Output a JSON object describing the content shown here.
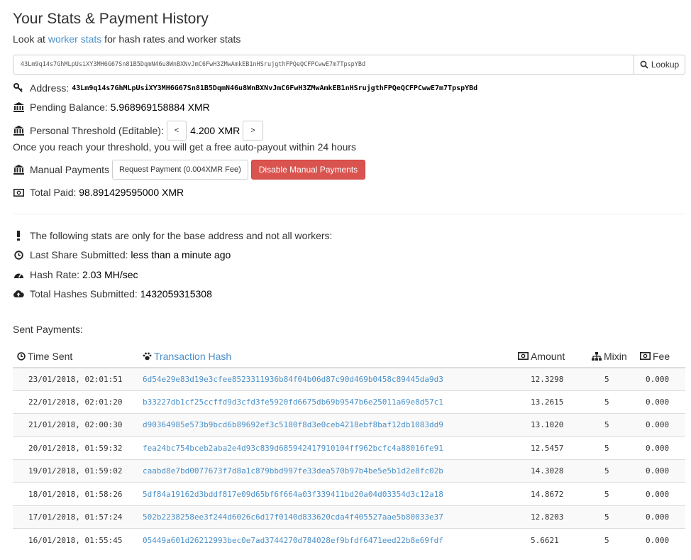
{
  "page": {
    "title": "Your Stats & Payment History",
    "subtitle_prefix": "Look at ",
    "subtitle_link": "worker stats",
    "subtitle_suffix": " for hash rates and worker stats"
  },
  "lookup": {
    "value": "43Lm9q14s7GhMLpUsiXY3MH6G67Sn81B5DqmN46u8WnBXNvJmC6FwH3ZMwAmkEB1nHSrujgthFPQeQCFPCwwE7m7TpspYBd",
    "button_label": "Lookup",
    "button_icon": "search-icon"
  },
  "stats": {
    "address_label": "Address:",
    "address_value": "43Lm9q14s7GhMLpUsiXY3MH6G67Sn81B5DqmN46u8WnBXNvJmC6FwH3ZMwAmkEB1nHSrujgthFPQeQCFPCwwE7m7TpspYBd",
    "pending_label": "Pending Balance:",
    "pending_value": "5.968969158884 XMR",
    "threshold_label": "Personal Threshold (Editable):",
    "threshold_dec": "<",
    "threshold_value": "4.200 XMR",
    "threshold_inc": ">",
    "threshold_note": "Once you reach your threshold, you will get a free auto-payout within 24 hours",
    "manual_label": "Manual Payments",
    "request_button": "Request Payment (0.004XMR Fee)",
    "disable_button": "Disable Manual Payments",
    "total_paid_label": "Total Paid:",
    "total_paid_value": "98.891429595000 XMR"
  },
  "base_stats": {
    "notice": "The following stats are only for the base address and not all workers:",
    "last_share_label": "Last Share Submitted:",
    "last_share_value": "less than a minute ago",
    "hash_rate_label": "Hash Rate:",
    "hash_rate_value": "2.03 MH/sec",
    "total_hashes_label": "Total Hashes Submitted:",
    "total_hashes_value": "1432059315308"
  },
  "payments": {
    "section_label": "Sent Payments:",
    "headers": {
      "time": "Time Sent",
      "hash": "Transaction Hash",
      "amount": "Amount",
      "mixin": "Mixin",
      "fee": "Fee"
    },
    "rows": [
      {
        "time": "23/01/2018, 02:01:51",
        "hash": "6d54e29e83d19e3cfee8523311936b84f04b06d87c90d469b0458c89445da9d3",
        "amount": "12.3298",
        "mixin": "5",
        "fee": "0.000"
      },
      {
        "time": "22/01/2018, 02:01:20",
        "hash": "b33227db1cf25ccffd9d3cfd3fe5920fd6675db69b9547b6e25011a69e8d57c1",
        "amount": "13.2615",
        "mixin": "5",
        "fee": "0.000"
      },
      {
        "time": "21/01/2018, 02:00:30",
        "hash": "d90364985e573b9bcd6b89692ef3c5180f8d3e0ceb4218ebf8baf12db1083dd9",
        "amount": "13.1020",
        "mixin": "5",
        "fee": "0.000"
      },
      {
        "time": "20/01/2018, 01:59:32",
        "hash": "fea24bc754bceb2aba2e4d93c839d685942417910104ff962bcfc4a88016fe91",
        "amount": "12.5457",
        "mixin": "5",
        "fee": "0.000"
      },
      {
        "time": "19/01/2018, 01:59:02",
        "hash": "caabd8e7bd0077673f7d8a1c879bbd997fe33dea570b97b4be5e5b1d2e8fc02b",
        "amount": "14.3028",
        "mixin": "5",
        "fee": "0.000"
      },
      {
        "time": "18/01/2018, 01:58:26",
        "hash": "5df84a19162d3bddf817e09d65bf6f664a03f339411bd20a04d03354d3c12a18",
        "amount": "14.8672",
        "mixin": "5",
        "fee": "0.000"
      },
      {
        "time": "17/01/2018, 01:57:24",
        "hash": "502b2238258ee3f244d6026c6d17f0140d833620cda4f405527aae5b80033e37",
        "amount": "12.8203",
        "mixin": "5",
        "fee": "0.000"
      },
      {
        "time": "16/01/2018, 01:55:45",
        "hash": "05449a601d26212993bec0e7ad3744270d784028ef9bfdf6471eed22b8e69fdf",
        "amount": "5.6621",
        "mixin": "5",
        "fee": "0.000"
      }
    ]
  },
  "colors": {
    "link": "#4a90c8",
    "danger": "#d9534f",
    "text": "#333333"
  }
}
